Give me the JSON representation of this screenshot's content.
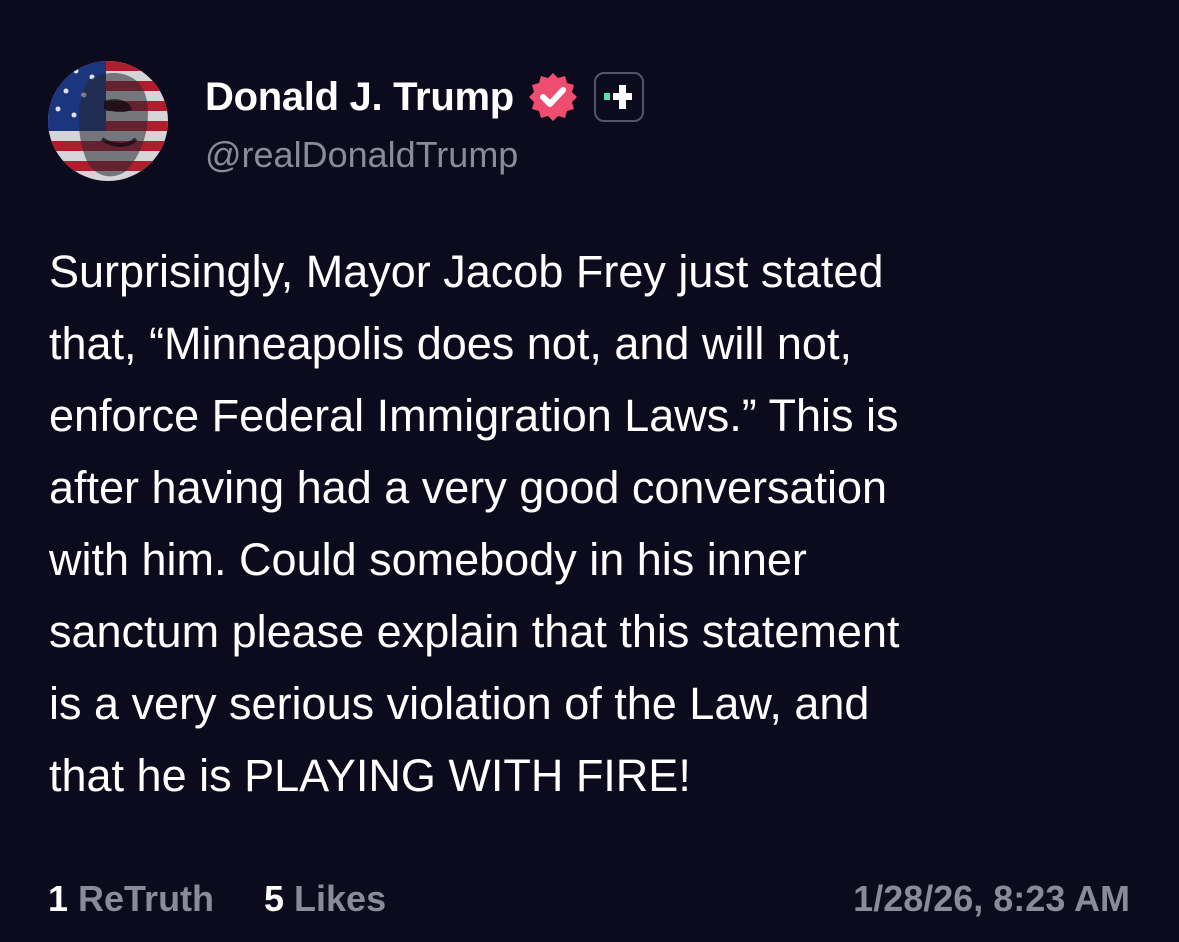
{
  "author": {
    "display_name": "Donald J. Trump",
    "handle": "@realDonaldTrump",
    "avatar_icon": "avatar-flag-portrait",
    "verified_icon": "verified-badge-icon",
    "plus_icon": "plus-badge-icon"
  },
  "post": {
    "lines": [
      "Surprisingly, Mayor Jacob Frey just stated",
      "that, “Minneapolis does not, and will not,",
      "enforce Federal Immigration Laws.” This is",
      "after having had a very good conversation",
      "with him. Could somebody in his inner",
      "sanctum please explain that this statement",
      "is a very serious violation of the Law, and",
      "that he is PLAYING WITH FIRE!"
    ]
  },
  "stats": {
    "retruths_count": "1",
    "retruths_label": "ReTruth",
    "likes_count": "5",
    "likes_label": "Likes",
    "timestamp": "1/28/26, 8:23 AM"
  },
  "colors": {
    "background": "#0c0b1d",
    "text": "#ffffff",
    "muted": "#8b8a98",
    "verified": "#ef4d6f",
    "plus_accent": "#4ee2b0"
  }
}
